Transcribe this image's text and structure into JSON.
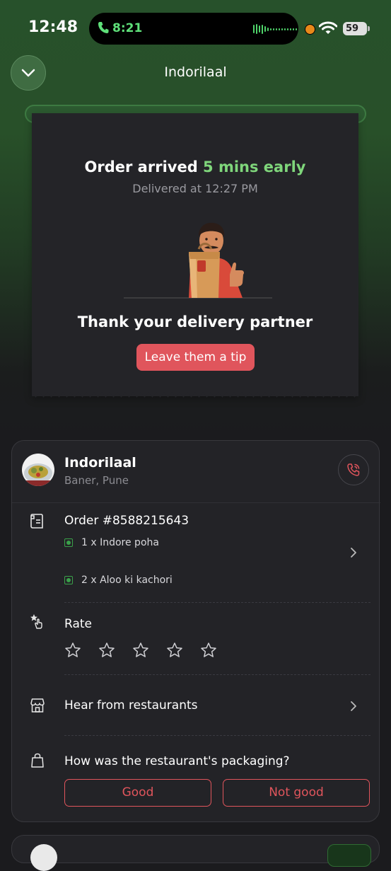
{
  "status_bar": {
    "time": "12:48",
    "call_time": "8:21",
    "battery": "59"
  },
  "header": {
    "title": "Indorilaal",
    "collapse_icon": "chevron-down-icon"
  },
  "receipt": {
    "arrived_prefix": "Order arrived",
    "arrived_highlight": "5 mins early",
    "delivered_at": "Delivered at 12:27 PM",
    "thank_text": "Thank your delivery partner",
    "tip_button": "Leave them a tip"
  },
  "restaurant": {
    "name": "Indorilaal",
    "location": "Baner, Pune",
    "call_icon": "phone-icon"
  },
  "order": {
    "number": "Order #8588215643",
    "items": [
      {
        "text": "1 x Indore poha"
      },
      {
        "text": "2 x Aloo ki kachori"
      }
    ]
  },
  "rate": {
    "label": "Rate",
    "stars_total": 5,
    "stars_filled": 0
  },
  "hear": {
    "label": "Hear from restaurants"
  },
  "packaging": {
    "question": "How was the restaurant's packaging?",
    "good": "Good",
    "not_good": "Not good"
  },
  "colors": {
    "accent_green": "#7fd67b",
    "accent_red": "#e0555c",
    "call_green": "#5fe07a"
  }
}
